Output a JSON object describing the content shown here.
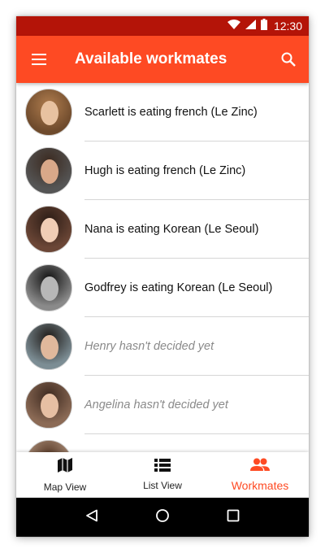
{
  "status_bar": {
    "time": "12:30",
    "icons": [
      "wifi-icon",
      "signal-icon",
      "battery-icon"
    ]
  },
  "app_bar": {
    "title": "Available workmates",
    "menu_icon": "menu-icon",
    "search_icon": "search-icon",
    "color": "#fe4a23"
  },
  "workmates": [
    {
      "text": "Scarlett is eating french (Le Zinc)",
      "decided": true
    },
    {
      "text": "Hugh is eating french (Le Zinc)",
      "decided": true
    },
    {
      "text": "Nana is eating Korean (Le Seoul)",
      "decided": true
    },
    {
      "text": "Godfrey is eating Korean (Le Seoul)",
      "decided": true
    },
    {
      "text": "Henry hasn't decided yet",
      "decided": false
    },
    {
      "text": "Angelina hasn't decided yet",
      "decided": false
    },
    {
      "text": "",
      "decided": false
    }
  ],
  "bottom_nav": {
    "items": [
      {
        "label": "Map View",
        "icon": "map-icon"
      },
      {
        "label": "List View",
        "icon": "list-icon"
      },
      {
        "label": "Workmates",
        "icon": "people-icon",
        "active": true
      }
    ],
    "active_color": "#fe4a23"
  },
  "system_nav": {
    "icons": [
      "back-icon",
      "home-icon",
      "recents-icon"
    ]
  }
}
